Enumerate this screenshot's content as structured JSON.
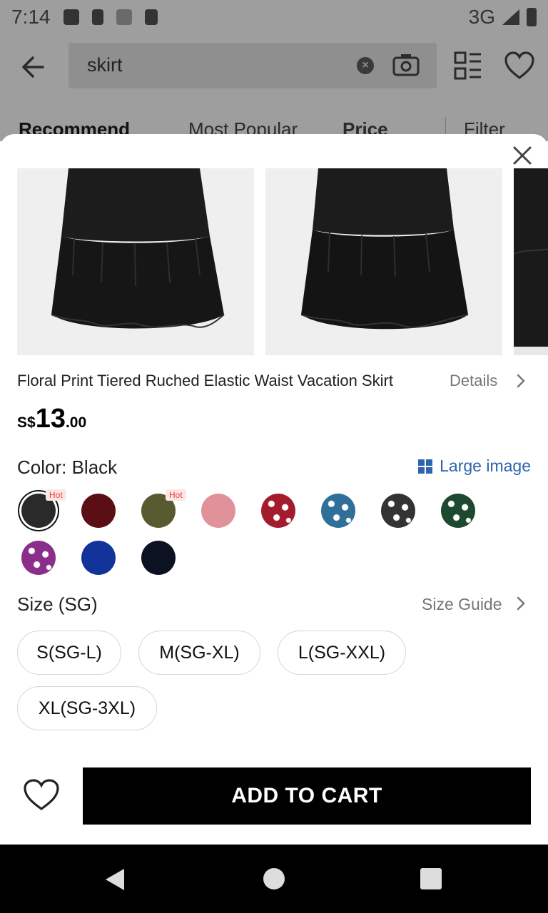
{
  "status_bar": {
    "time": "7:14",
    "network": "3G"
  },
  "search": {
    "query": "skirt"
  },
  "sort_tabs": {
    "recommend": "Recommend",
    "most_popular": "Most Popular",
    "price": "Price",
    "filter": "Filter"
  },
  "product": {
    "title": "Floral Print Tiered Ruched Elastic Waist Vacation Skirt",
    "details_label": "Details",
    "price": {
      "currency": "S$",
      "integer": "13",
      "decimal": ".00"
    }
  },
  "color": {
    "label": "Color: Black",
    "large_image_label": "Large image",
    "swatches": [
      {
        "name": "black",
        "hex": "#2a2a2a",
        "selected": true,
        "badge": "Hot"
      },
      {
        "name": "burgundy",
        "hex": "#5b0f14",
        "badge": ""
      },
      {
        "name": "olive",
        "hex": "#585a30",
        "badge": "Hot"
      },
      {
        "name": "pink",
        "hex": "#e0919a",
        "badge": ""
      },
      {
        "name": "red-floral",
        "hex": "#a31b2c",
        "badge": ""
      },
      {
        "name": "blue-floral",
        "hex": "#2f6f9a",
        "badge": ""
      },
      {
        "name": "black-floral",
        "hex": "#333333",
        "badge": ""
      },
      {
        "name": "green-floral",
        "hex": "#1d4a2e",
        "badge": ""
      },
      {
        "name": "purple-floral",
        "hex": "#8a2e8a",
        "badge": ""
      },
      {
        "name": "royal-blue",
        "hex": "#11339a",
        "badge": ""
      },
      {
        "name": "navy",
        "hex": "#0d1222",
        "badge": ""
      }
    ]
  },
  "size": {
    "label": "Size (SG)",
    "guide_label": "Size Guide",
    "options": [
      "S(SG-L)",
      "M(SG-XL)",
      "L(SG-XXL)",
      "XL(SG-3XL)"
    ]
  },
  "actions": {
    "add_to_cart": "ADD TO CART"
  }
}
